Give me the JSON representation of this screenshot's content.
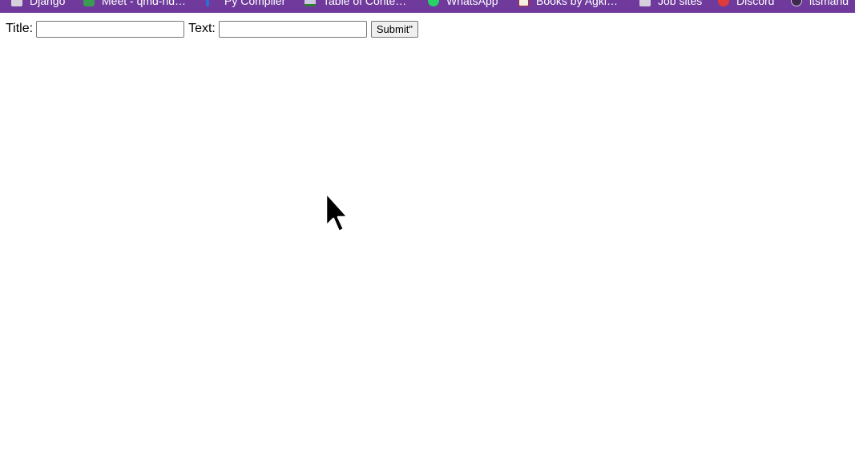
{
  "bookmarks": {
    "items": [
      {
        "label": "Django",
        "icon": "folder-icon"
      },
      {
        "label": "Meet - qmd-nd…",
        "icon": "google-meet-icon"
      },
      {
        "label": "Py Compiler",
        "icon": "py-compiler-icon"
      },
      {
        "label": "Table of Conte…",
        "icon": "table-of-contents-icon"
      },
      {
        "label": "WhatsApp",
        "icon": "whatsapp-icon"
      },
      {
        "label": "Books by Agki…",
        "icon": "books-icon"
      },
      {
        "label": "Job sites",
        "icon": "folder-icon"
      },
      {
        "label": "Discord",
        "icon": "discord-icon"
      },
      {
        "label": "itsmand",
        "icon": "github-icon"
      }
    ],
    "bar_color": "#6f3a9c"
  },
  "form": {
    "title_label": "Title:",
    "title_value": "",
    "text_label": "Text:",
    "text_value": "",
    "submit_label": "Submit\""
  },
  "cursor": {
    "icon": "mouse-pointer-icon"
  }
}
